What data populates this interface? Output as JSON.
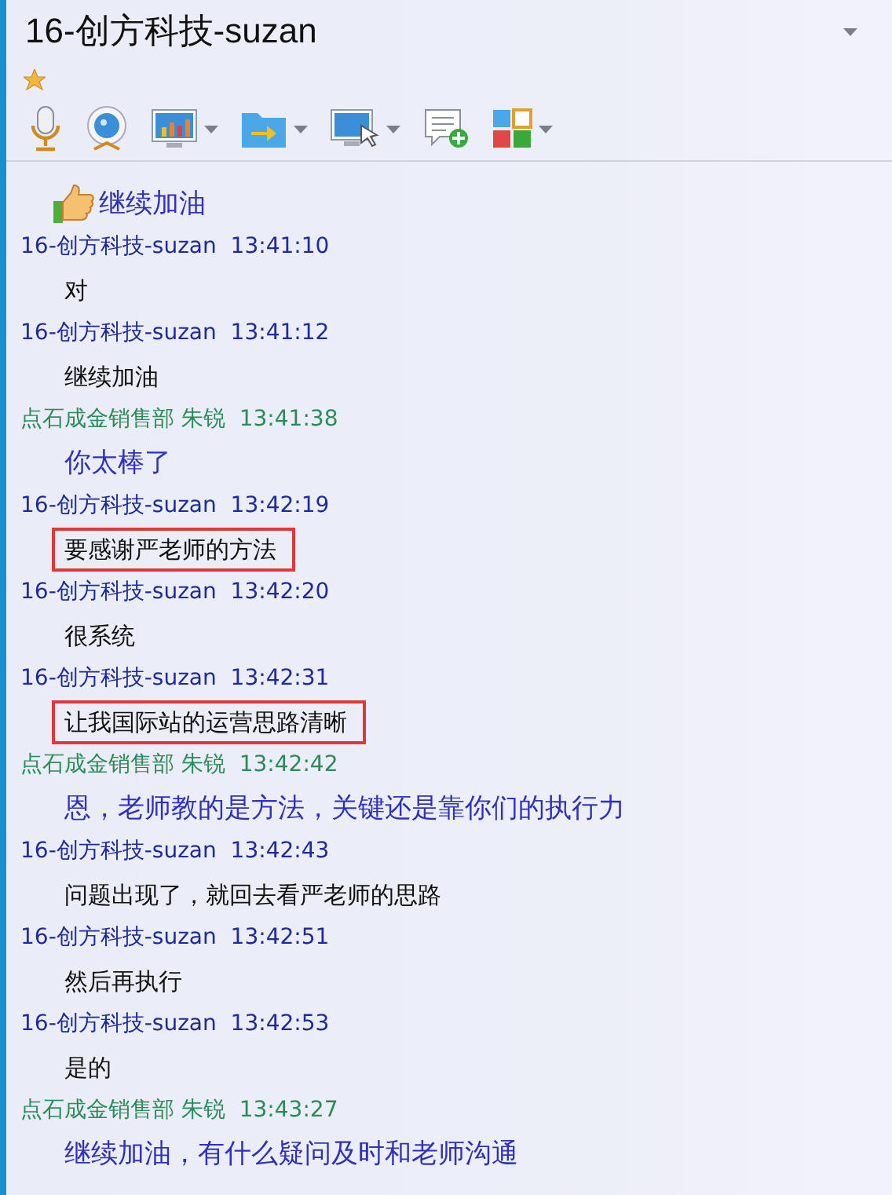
{
  "window": {
    "title": "16-创方科技-suzan",
    "favorite": true
  },
  "toolbar": [
    {
      "kind": "mic",
      "dropdown": false
    },
    {
      "kind": "webcam",
      "dropdown": false
    },
    {
      "kind": "chart",
      "dropdown": true
    },
    {
      "kind": "folder",
      "dropdown": true
    },
    {
      "kind": "screen",
      "dropdown": true
    },
    {
      "kind": "chat",
      "dropdown": false
    },
    {
      "kind": "apps",
      "dropdown": true
    }
  ],
  "messages": [
    {
      "kind": "other",
      "sticker": true,
      "text": "继续加油",
      "highlighted": false
    },
    {
      "kind": "self",
      "sender": "16-创方科技-suzan",
      "time": "13:41:10",
      "text": "对",
      "highlighted": false
    },
    {
      "kind": "self",
      "sender": "16-创方科技-suzan",
      "time": "13:41:12",
      "text": "继续加油",
      "highlighted": false
    },
    {
      "kind": "other",
      "sender": "点石成金销售部 朱锐",
      "time": "13:41:38",
      "text": "你太棒了",
      "highlighted": false
    },
    {
      "kind": "self",
      "sender": "16-创方科技-suzan",
      "time": "13:42:19",
      "text": "要感谢严老师的方法",
      "highlighted": true
    },
    {
      "kind": "self",
      "sender": "16-创方科技-suzan",
      "time": "13:42:20",
      "text": "很系统",
      "highlighted": false
    },
    {
      "kind": "self",
      "sender": "16-创方科技-suzan",
      "time": "13:42:31",
      "text": "让我国际站的运营思路清晰",
      "highlighted": true
    },
    {
      "kind": "other",
      "sender": "点石成金销售部 朱锐",
      "time": "13:42:42",
      "text": "恩，老师教的是方法，关键还是靠你们的执行力",
      "highlighted": false
    },
    {
      "kind": "self",
      "sender": "16-创方科技-suzan",
      "time": "13:42:43",
      "text": "问题出现了，就回去看严老师的思路",
      "highlighted": false
    },
    {
      "kind": "self",
      "sender": "16-创方科技-suzan",
      "time": "13:42:51",
      "text": "然后再执行",
      "highlighted": false
    },
    {
      "kind": "self",
      "sender": "16-创方科技-suzan",
      "time": "13:42:53",
      "text": "是的",
      "highlighted": false
    },
    {
      "kind": "other",
      "sender": "点石成金销售部 朱锐",
      "time": "13:43:27",
      "text": "继续加油，有什么疑问及时和老师沟通",
      "highlighted": false
    }
  ]
}
